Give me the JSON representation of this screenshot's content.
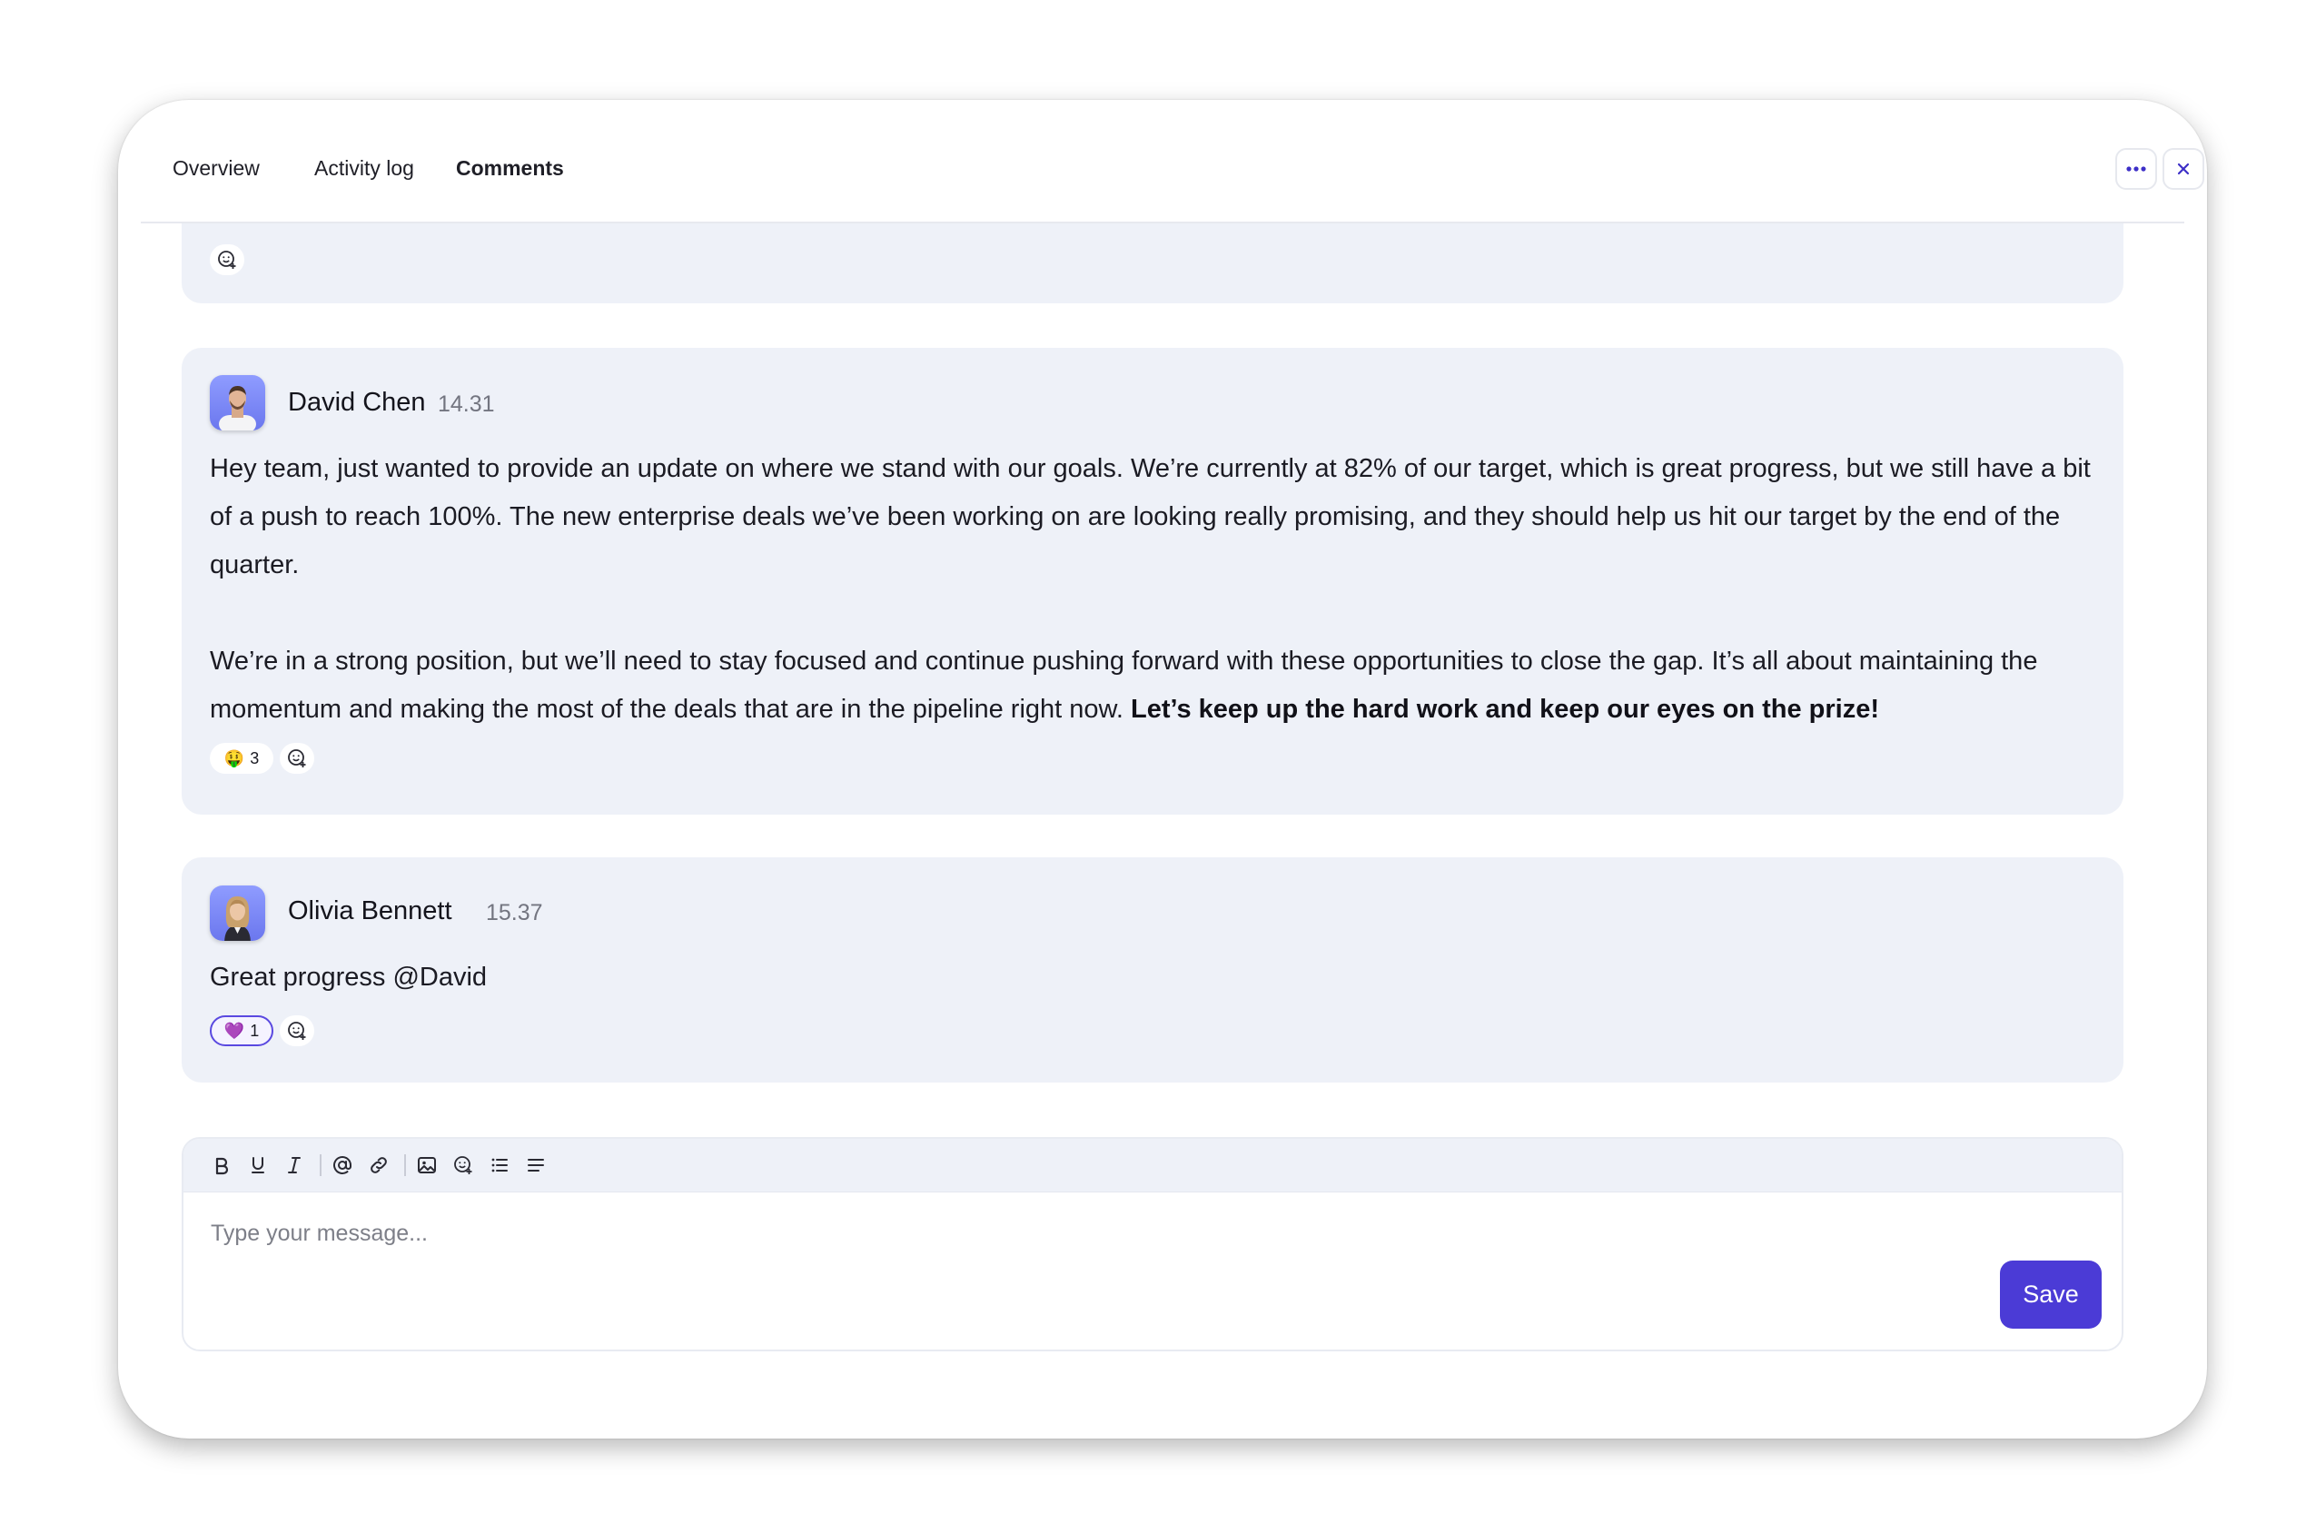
{
  "tabs": [
    {
      "label": "Overview",
      "active": false
    },
    {
      "label": "Activity log",
      "active": false
    },
    {
      "label": "Comments",
      "active": true
    }
  ],
  "header_actions": [
    {
      "icon": "more-horizontal-icon"
    },
    {
      "icon": "close-icon"
    }
  ],
  "comments": [
    {
      "author": "David Chen",
      "time": "14.31",
      "paragraph1": "Hey team, just wanted to provide an update on where we stand with our goals. We’re currently at 82% of our target, which is great progress, but we still have a bit of a push to reach 100%. The new enterprise deals we’ve been working on are looking really promising, and they should help us hit our target by the end of the quarter.",
      "paragraph2": "We’re in a strong position, but we’ll need to stay focused and continue pushing forward with these opportunities to close the gap. It’s all about maintaining the momentum and making the most of the deals that are in the pipeline right now.",
      "paragraph2_bold": "Let’s keep up the hard work and keep our eyes on the prize!",
      "reaction": {
        "emoji": "🤑",
        "count": "3"
      }
    },
    {
      "author": "Olivia Bennett",
      "time": "15.37",
      "text": "Great progress @David",
      "reaction": {
        "emoji": "💜",
        "count": "1"
      }
    }
  ],
  "editor": {
    "toolbar": [
      "bold-icon",
      "underline-icon",
      "italic-icon",
      "mention-icon",
      "link-icon",
      "image-icon",
      "emoji-icon",
      "bulleted-list-icon",
      "align-icon"
    ],
    "placeholder": "Type your message...",
    "save_label": "Save"
  },
  "colors": {
    "accent": "#4b3bd6",
    "card_background": "#eef1f8",
    "timestamp": "#737580"
  }
}
